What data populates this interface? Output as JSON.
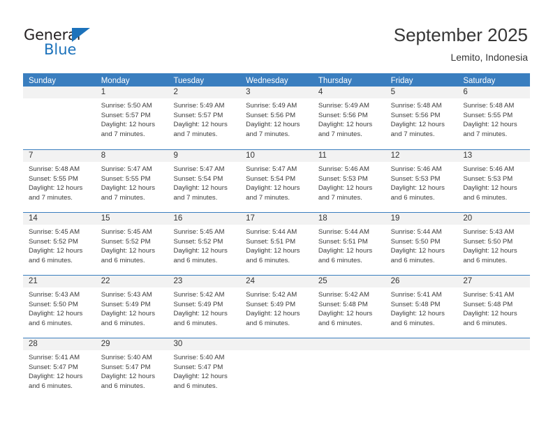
{
  "brand": {
    "name_part1": "General",
    "name_part2": "Blue",
    "triangle_icon": "triangle-icon",
    "accent_color": "#1c72bb"
  },
  "header": {
    "title": "September 2025",
    "subtitle": "Lemito, Indonesia"
  },
  "colors": {
    "header_blue": "#3a7ebf",
    "date_strip": "#f2f2f2",
    "text": "#3b3b3b"
  },
  "weekdays": [
    "Sunday",
    "Monday",
    "Tuesday",
    "Wednesday",
    "Thursday",
    "Friday",
    "Saturday"
  ],
  "labels": {
    "sunrise_prefix": "Sunrise:",
    "sunset_prefix": "Sunset:",
    "daylight_prefix": "Daylight:"
  },
  "weeks": [
    [
      {
        "date": "",
        "empty": true,
        "line1": "",
        "line2": "",
        "line3": "",
        "line4": ""
      },
      {
        "date": "1",
        "empty": false,
        "line1": "Sunrise: 5:50 AM",
        "line2": "Sunset: 5:57 PM",
        "line3": "Daylight: 12 hours",
        "line4": "and 7 minutes."
      },
      {
        "date": "2",
        "empty": false,
        "line1": "Sunrise: 5:49 AM",
        "line2": "Sunset: 5:57 PM",
        "line3": "Daylight: 12 hours",
        "line4": "and 7 minutes."
      },
      {
        "date": "3",
        "empty": false,
        "line1": "Sunrise: 5:49 AM",
        "line2": "Sunset: 5:56 PM",
        "line3": "Daylight: 12 hours",
        "line4": "and 7 minutes."
      },
      {
        "date": "4",
        "empty": false,
        "line1": "Sunrise: 5:49 AM",
        "line2": "Sunset: 5:56 PM",
        "line3": "Daylight: 12 hours",
        "line4": "and 7 minutes."
      },
      {
        "date": "5",
        "empty": false,
        "line1": "Sunrise: 5:48 AM",
        "line2": "Sunset: 5:56 PM",
        "line3": "Daylight: 12 hours",
        "line4": "and 7 minutes."
      },
      {
        "date": "6",
        "empty": false,
        "line1": "Sunrise: 5:48 AM",
        "line2": "Sunset: 5:55 PM",
        "line3": "Daylight: 12 hours",
        "line4": "and 7 minutes."
      }
    ],
    [
      {
        "date": "7",
        "empty": false,
        "line1": "Sunrise: 5:48 AM",
        "line2": "Sunset: 5:55 PM",
        "line3": "Daylight: 12 hours",
        "line4": "and 7 minutes."
      },
      {
        "date": "8",
        "empty": false,
        "line1": "Sunrise: 5:47 AM",
        "line2": "Sunset: 5:55 PM",
        "line3": "Daylight: 12 hours",
        "line4": "and 7 minutes."
      },
      {
        "date": "9",
        "empty": false,
        "line1": "Sunrise: 5:47 AM",
        "line2": "Sunset: 5:54 PM",
        "line3": "Daylight: 12 hours",
        "line4": "and 7 minutes."
      },
      {
        "date": "10",
        "empty": false,
        "line1": "Sunrise: 5:47 AM",
        "line2": "Sunset: 5:54 PM",
        "line3": "Daylight: 12 hours",
        "line4": "and 7 minutes."
      },
      {
        "date": "11",
        "empty": false,
        "line1": "Sunrise: 5:46 AM",
        "line2": "Sunset: 5:53 PM",
        "line3": "Daylight: 12 hours",
        "line4": "and 7 minutes."
      },
      {
        "date": "12",
        "empty": false,
        "line1": "Sunrise: 5:46 AM",
        "line2": "Sunset: 5:53 PM",
        "line3": "Daylight: 12 hours",
        "line4": "and 6 minutes."
      },
      {
        "date": "13",
        "empty": false,
        "line1": "Sunrise: 5:46 AM",
        "line2": "Sunset: 5:53 PM",
        "line3": "Daylight: 12 hours",
        "line4": "and 6 minutes."
      }
    ],
    [
      {
        "date": "14",
        "empty": false,
        "line1": "Sunrise: 5:45 AM",
        "line2": "Sunset: 5:52 PM",
        "line3": "Daylight: 12 hours",
        "line4": "and 6 minutes."
      },
      {
        "date": "15",
        "empty": false,
        "line1": "Sunrise: 5:45 AM",
        "line2": "Sunset: 5:52 PM",
        "line3": "Daylight: 12 hours",
        "line4": "and 6 minutes."
      },
      {
        "date": "16",
        "empty": false,
        "line1": "Sunrise: 5:45 AM",
        "line2": "Sunset: 5:52 PM",
        "line3": "Daylight: 12 hours",
        "line4": "and 6 minutes."
      },
      {
        "date": "17",
        "empty": false,
        "line1": "Sunrise: 5:44 AM",
        "line2": "Sunset: 5:51 PM",
        "line3": "Daylight: 12 hours",
        "line4": "and 6 minutes."
      },
      {
        "date": "18",
        "empty": false,
        "line1": "Sunrise: 5:44 AM",
        "line2": "Sunset: 5:51 PM",
        "line3": "Daylight: 12 hours",
        "line4": "and 6 minutes."
      },
      {
        "date": "19",
        "empty": false,
        "line1": "Sunrise: 5:44 AM",
        "line2": "Sunset: 5:50 PM",
        "line3": "Daylight: 12 hours",
        "line4": "and 6 minutes."
      },
      {
        "date": "20",
        "empty": false,
        "line1": "Sunrise: 5:43 AM",
        "line2": "Sunset: 5:50 PM",
        "line3": "Daylight: 12 hours",
        "line4": "and 6 minutes."
      }
    ],
    [
      {
        "date": "21",
        "empty": false,
        "line1": "Sunrise: 5:43 AM",
        "line2": "Sunset: 5:50 PM",
        "line3": "Daylight: 12 hours",
        "line4": "and 6 minutes."
      },
      {
        "date": "22",
        "empty": false,
        "line1": "Sunrise: 5:43 AM",
        "line2": "Sunset: 5:49 PM",
        "line3": "Daylight: 12 hours",
        "line4": "and 6 minutes."
      },
      {
        "date": "23",
        "empty": false,
        "line1": "Sunrise: 5:42 AM",
        "line2": "Sunset: 5:49 PM",
        "line3": "Daylight: 12 hours",
        "line4": "and 6 minutes."
      },
      {
        "date": "24",
        "empty": false,
        "line1": "Sunrise: 5:42 AM",
        "line2": "Sunset: 5:49 PM",
        "line3": "Daylight: 12 hours",
        "line4": "and 6 minutes."
      },
      {
        "date": "25",
        "empty": false,
        "line1": "Sunrise: 5:42 AM",
        "line2": "Sunset: 5:48 PM",
        "line3": "Daylight: 12 hours",
        "line4": "and 6 minutes."
      },
      {
        "date": "26",
        "empty": false,
        "line1": "Sunrise: 5:41 AM",
        "line2": "Sunset: 5:48 PM",
        "line3": "Daylight: 12 hours",
        "line4": "and 6 minutes."
      },
      {
        "date": "27",
        "empty": false,
        "line1": "Sunrise: 5:41 AM",
        "line2": "Sunset: 5:48 PM",
        "line3": "Daylight: 12 hours",
        "line4": "and 6 minutes."
      }
    ],
    [
      {
        "date": "28",
        "empty": false,
        "line1": "Sunrise: 5:41 AM",
        "line2": "Sunset: 5:47 PM",
        "line3": "Daylight: 12 hours",
        "line4": "and 6 minutes."
      },
      {
        "date": "29",
        "empty": false,
        "line1": "Sunrise: 5:40 AM",
        "line2": "Sunset: 5:47 PM",
        "line3": "Daylight: 12 hours",
        "line4": "and 6 minutes."
      },
      {
        "date": "30",
        "empty": false,
        "line1": "Sunrise: 5:40 AM",
        "line2": "Sunset: 5:47 PM",
        "line3": "Daylight: 12 hours",
        "line4": "and 6 minutes."
      },
      {
        "date": "",
        "empty": true,
        "line1": "",
        "line2": "",
        "line3": "",
        "line4": ""
      },
      {
        "date": "",
        "empty": true,
        "line1": "",
        "line2": "",
        "line3": "",
        "line4": ""
      },
      {
        "date": "",
        "empty": true,
        "line1": "",
        "line2": "",
        "line3": "",
        "line4": ""
      },
      {
        "date": "",
        "empty": true,
        "line1": "",
        "line2": "",
        "line3": "",
        "line4": ""
      }
    ]
  ]
}
